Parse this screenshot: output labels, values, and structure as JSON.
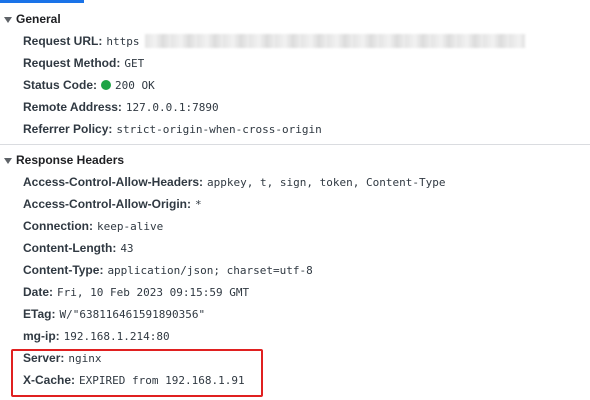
{
  "general": {
    "title": "General",
    "request_url": {
      "key": "Request URL",
      "value": "https"
    },
    "request_method": {
      "key": "Request Method",
      "value": "GET"
    },
    "status_code": {
      "key": "Status Code",
      "value": "200 OK",
      "status_color": "#1ea446"
    },
    "remote_address": {
      "key": "Remote Address",
      "value": "127.0.0.1:7890"
    },
    "referrer_policy": {
      "key": "Referrer Policy",
      "value": "strict-origin-when-cross-origin"
    }
  },
  "response_headers": {
    "title": "Response Headers",
    "rows": [
      {
        "key": "Access-Control-Allow-Headers",
        "value": "appkey, t, sign, token, Content-Type"
      },
      {
        "key": "Access-Control-Allow-Origin",
        "value": "*"
      },
      {
        "key": "Connection",
        "value": "keep-alive"
      },
      {
        "key": "Content-Length",
        "value": "43"
      },
      {
        "key": "Content-Type",
        "value": "application/json; charset=utf-8"
      },
      {
        "key": "Date",
        "value": "Fri, 10 Feb 2023 09:15:59 GMT"
      },
      {
        "key": "ETag",
        "value": "W/\"638116461591890356\""
      },
      {
        "key": "mg-ip",
        "value": "192.168.1.214:80"
      },
      {
        "key": "Server",
        "value": "nginx"
      },
      {
        "key": "X-Cache",
        "value": "EXPIRED from 192.168.1.91"
      }
    ]
  },
  "colors": {
    "accent": "#1a73e8",
    "highlight": "#e02020"
  }
}
